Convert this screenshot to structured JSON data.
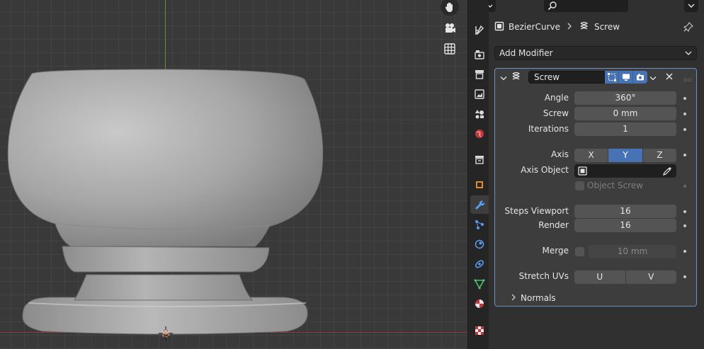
{
  "header": {
    "editor_type_icon": "properties-editor-icon",
    "search_placeholder": ""
  },
  "breadcrumb": {
    "object": "BezierCurve",
    "object_icon": "curve-object-icon",
    "modifier": "Screw",
    "modifier_icon": "screw-modifier-icon"
  },
  "add_modifier": {
    "label": "Add Modifier"
  },
  "modifier": {
    "name": "Screw",
    "rows": {
      "angle": {
        "label": "Angle",
        "value": "360°"
      },
      "screw": {
        "label": "Screw",
        "value": "0 mm"
      },
      "iterations": {
        "label": "Iterations",
        "value": "1"
      },
      "axis": {
        "label": "Axis",
        "options": [
          "X",
          "Y",
          "Z"
        ],
        "selected": "Y"
      },
      "axis_object": {
        "label": "Axis Object",
        "value": ""
      },
      "object_screw": {
        "label": "Object Screw",
        "checked": false
      },
      "steps_viewport": {
        "label": "Steps Viewport",
        "value": "16"
      },
      "render": {
        "label": "Render",
        "value": "16"
      },
      "merge": {
        "label": "Merge",
        "checked": false,
        "value": "10 mm"
      },
      "stretch_uvs": {
        "label": "Stretch UVs",
        "u": "U",
        "v": "V"
      }
    },
    "normals": {
      "label": "Normals",
      "expanded": false
    }
  },
  "tabs": [
    "tool-icon",
    "render-icon",
    "output-icon",
    "view-layer-icon",
    "scene-icon",
    "world-icon",
    "collection-icon",
    "object-icon",
    "modifier-wrench-icon",
    "particles-icon",
    "physics-icon",
    "constraints-icon",
    "object-data-icon",
    "material-icon",
    "texture-icon"
  ],
  "active_tab": "modifier-wrench-icon",
  "colors": {
    "accent": "#4772b3",
    "panel_outline": "#6e8fc4",
    "grid_bg": "#393939",
    "x_axis": "#93363c",
    "y_axis": "#6f8f2a"
  }
}
